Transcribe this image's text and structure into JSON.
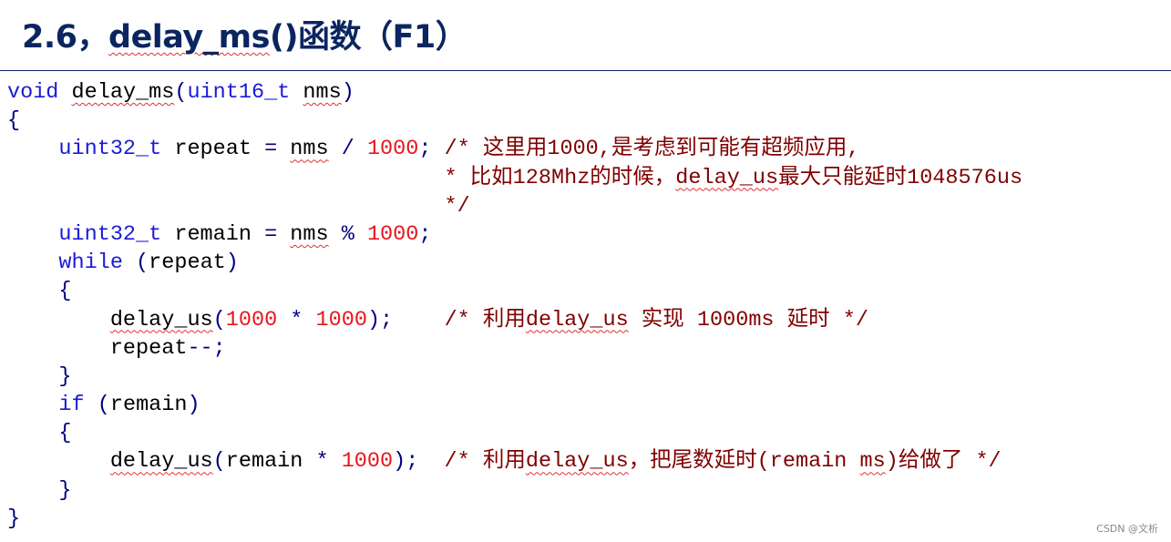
{
  "title": {
    "prefix": "2.6，",
    "func": "delay_ms",
    "suffix": "()函数（F1）"
  },
  "code_lines": [
    [
      {
        "t": "void",
        "c": "kw"
      },
      {
        "t": " ",
        "c": "id"
      },
      {
        "t": "delay_ms",
        "c": "id",
        "sq": true
      },
      {
        "t": "(",
        "c": "op"
      },
      {
        "t": "uint16_t",
        "c": "kw"
      },
      {
        "t": " ",
        "c": "id"
      },
      {
        "t": "nms",
        "c": "id",
        "sq": true
      },
      {
        "t": ")",
        "c": "op"
      }
    ],
    [
      {
        "t": "{",
        "c": "op"
      }
    ],
    [
      {
        "t": "    ",
        "c": "id"
      },
      {
        "t": "uint32_t",
        "c": "kw"
      },
      {
        "t": " repeat ",
        "c": "id"
      },
      {
        "t": "=",
        "c": "op"
      },
      {
        "t": " ",
        "c": "id"
      },
      {
        "t": "nms",
        "c": "id",
        "sq": true
      },
      {
        "t": " ",
        "c": "id"
      },
      {
        "t": "/",
        "c": "op"
      },
      {
        "t": " ",
        "c": "id"
      },
      {
        "t": "1000",
        "c": "num"
      },
      {
        "t": ";",
        "c": "op"
      },
      {
        "t": " /* 这里用1000,是考虑到可能有超频应用,",
        "c": "cm"
      }
    ],
    [
      {
        "t": "                                  * 比如128Mhz的时候，",
        "c": "cm"
      },
      {
        "t": "delay_us",
        "c": "cm",
        "sq": true
      },
      {
        "t": "最大只能延时1048576us",
        "c": "cm"
      }
    ],
    [
      {
        "t": "                                  */",
        "c": "cm"
      }
    ],
    [
      {
        "t": "    ",
        "c": "id"
      },
      {
        "t": "uint32_t",
        "c": "kw"
      },
      {
        "t": " remain ",
        "c": "id"
      },
      {
        "t": "=",
        "c": "op"
      },
      {
        "t": " ",
        "c": "id"
      },
      {
        "t": "nms",
        "c": "id",
        "sq": true
      },
      {
        "t": " ",
        "c": "id"
      },
      {
        "t": "%",
        "c": "op"
      },
      {
        "t": " ",
        "c": "id"
      },
      {
        "t": "1000",
        "c": "num"
      },
      {
        "t": ";",
        "c": "op"
      }
    ],
    [
      {
        "t": "    ",
        "c": "id"
      },
      {
        "t": "while",
        "c": "kw"
      },
      {
        "t": " ",
        "c": "id"
      },
      {
        "t": "(",
        "c": "op"
      },
      {
        "t": "repeat",
        "c": "id"
      },
      {
        "t": ")",
        "c": "op"
      }
    ],
    [
      {
        "t": "    ",
        "c": "id"
      },
      {
        "t": "{",
        "c": "op"
      }
    ],
    [
      {
        "t": "        ",
        "c": "id"
      },
      {
        "t": "delay_us",
        "c": "id",
        "sq": true
      },
      {
        "t": "(",
        "c": "op"
      },
      {
        "t": "1000",
        "c": "num"
      },
      {
        "t": " ",
        "c": "id"
      },
      {
        "t": "*",
        "c": "op"
      },
      {
        "t": " ",
        "c": "id"
      },
      {
        "t": "1000",
        "c": "num"
      },
      {
        "t": ");",
        "c": "op"
      },
      {
        "t": "    /* 利用",
        "c": "cm"
      },
      {
        "t": "delay_us",
        "c": "cm",
        "sq": true
      },
      {
        "t": " 实现 1000ms 延时 */",
        "c": "cm"
      }
    ],
    [
      {
        "t": "        repeat",
        "c": "id"
      },
      {
        "t": "--;",
        "c": "op"
      }
    ],
    [
      {
        "t": "    ",
        "c": "id"
      },
      {
        "t": "}",
        "c": "op"
      }
    ],
    [
      {
        "t": "    ",
        "c": "id"
      },
      {
        "t": "if",
        "c": "kw"
      },
      {
        "t": " ",
        "c": "id"
      },
      {
        "t": "(",
        "c": "op"
      },
      {
        "t": "remain",
        "c": "id"
      },
      {
        "t": ")",
        "c": "op"
      }
    ],
    [
      {
        "t": "    ",
        "c": "id"
      },
      {
        "t": "{",
        "c": "op"
      }
    ],
    [
      {
        "t": "        ",
        "c": "id"
      },
      {
        "t": "delay_us",
        "c": "id",
        "sq": true
      },
      {
        "t": "(",
        "c": "op"
      },
      {
        "t": "remain ",
        "c": "id"
      },
      {
        "t": "*",
        "c": "op"
      },
      {
        "t": " ",
        "c": "id"
      },
      {
        "t": "1000",
        "c": "num"
      },
      {
        "t": ");",
        "c": "op"
      },
      {
        "t": "  /* 利用",
        "c": "cm"
      },
      {
        "t": "delay_us",
        "c": "cm",
        "sq": true
      },
      {
        "t": "，把尾数延时(remain ",
        "c": "cm"
      },
      {
        "t": "ms",
        "c": "cm",
        "sq": true
      },
      {
        "t": ")给做了 */",
        "c": "cm"
      }
    ],
    [
      {
        "t": "    ",
        "c": "id"
      },
      {
        "t": "}",
        "c": "op"
      }
    ],
    [
      {
        "t": "}",
        "c": "op"
      }
    ]
  ],
  "watermark": "CSDN @文析",
  "colors": {
    "title": "#0b2560",
    "keyword": "#1b1bd8",
    "number": "#e8141b",
    "operator": "#00007f",
    "comment": "#800000"
  }
}
